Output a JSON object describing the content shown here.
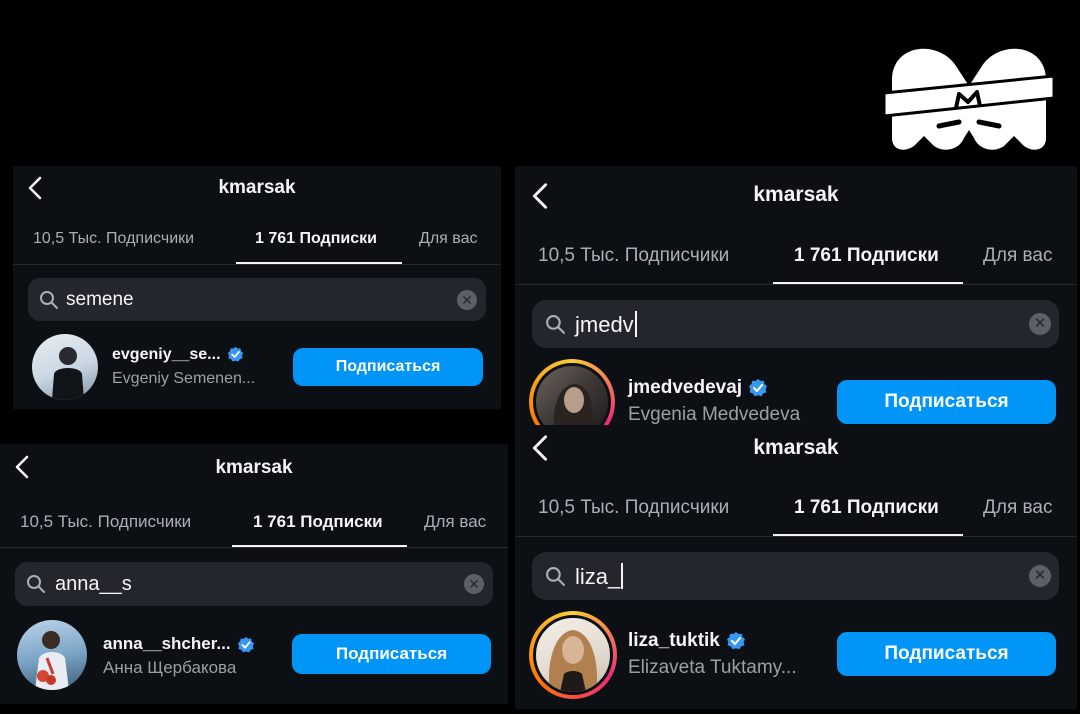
{
  "colors": {
    "accent": "#0095f6",
    "panel_bg": "#0c1015",
    "search_bg": "#23272d",
    "verified": "#3897f0"
  },
  "panels": [
    {
      "title": "kmarsak",
      "tabs": [
        "10,5 Тыс. Подписчики",
        "1 761 Подписки",
        "Для вас"
      ],
      "active_tab": 1,
      "search": {
        "value": "semene",
        "placeholder": ""
      },
      "result": {
        "username": "evgeniy__se...",
        "full_name": "Evgeniy Semenen...",
        "verified": true,
        "story_ring": false,
        "button": "Подписаться"
      }
    },
    {
      "title": "kmarsak",
      "tabs": [
        "10,5 Тыс. Подписчики",
        "1 761 Подписки",
        "Для вас"
      ],
      "active_tab": 1,
      "search": {
        "value": "anna__s",
        "placeholder": ""
      },
      "result": {
        "username": "anna__shcher...",
        "full_name": "Анна Щербакова",
        "verified": true,
        "story_ring": false,
        "button": "Подписаться"
      }
    },
    {
      "title": "kmarsak",
      "tabs": [
        "10,5 Тыс. Подписчики",
        "1 761 Подписки",
        "Для вас"
      ],
      "active_tab": 1,
      "search": {
        "value": "jmedv",
        "placeholder": ""
      },
      "result": {
        "username": "jmedvedevaj",
        "full_name": "Evgenia Medvedeva",
        "verified": true,
        "story_ring": true,
        "button": "Подписаться"
      }
    },
    {
      "title": "kmarsak",
      "tabs": [
        "10,5 Тыс. Подписчики",
        "1 761 Подписки",
        "Для вас"
      ],
      "active_tab": 1,
      "search": {
        "value": "liza_",
        "placeholder": ""
      },
      "result": {
        "username": "liza_tuktik",
        "full_name": "Elizaveta Tuktamy...",
        "verified": true,
        "story_ring": true,
        "button": "Подписаться"
      }
    }
  ],
  "icons": {
    "back": "chevron-left-icon",
    "search": "search-icon",
    "clear": "clear-icon",
    "verified": "verified-badge-icon",
    "logo": "match-tv-logo"
  }
}
